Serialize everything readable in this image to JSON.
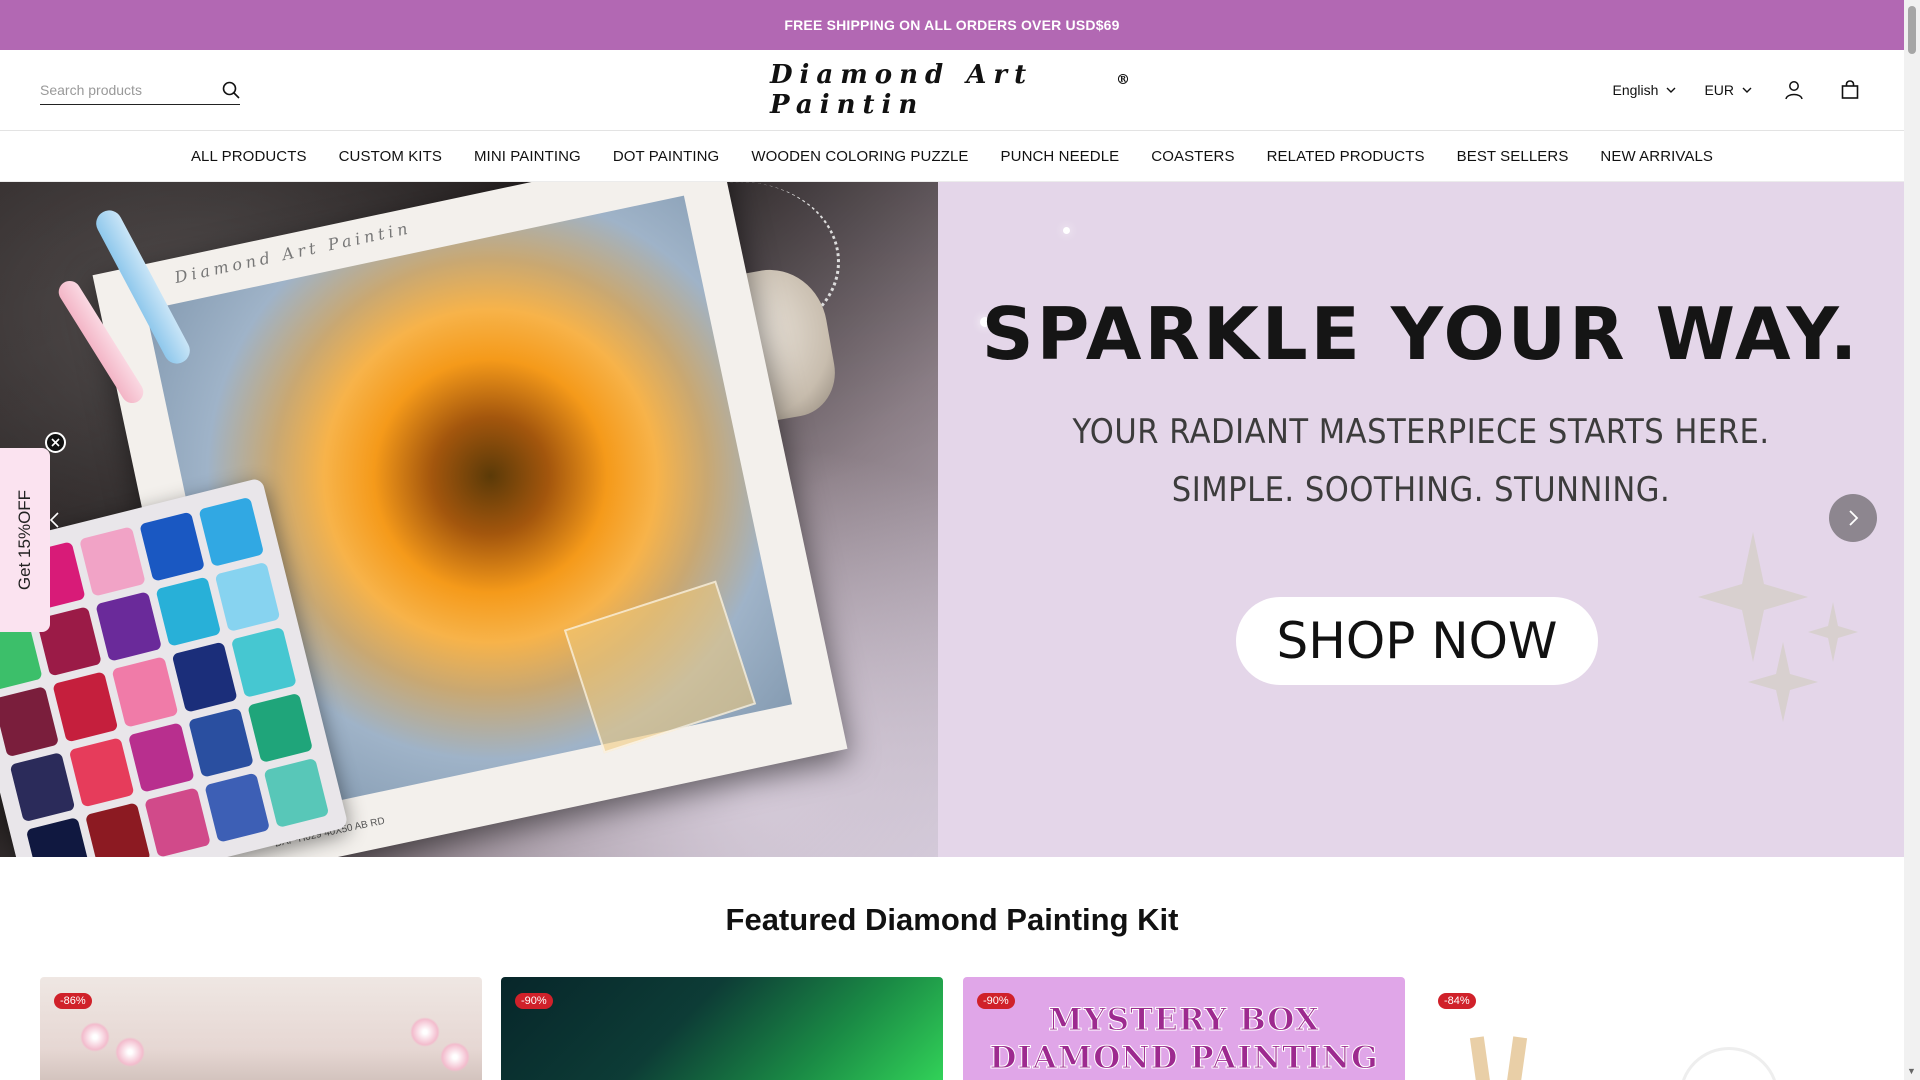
{
  "announcement": "FREE SHIPPING ON ALL ORDERS OVER USD$69",
  "header": {
    "search_placeholder": "Search products",
    "logo_text": "Diamond Art Paintin",
    "logo_mark": "®",
    "language": "English",
    "currency": "EUR"
  },
  "nav": [
    "ALL PRODUCTS",
    "CUSTOM KITS",
    "MINI PAINTING",
    "DOT PAINTING",
    "WOODEN COLORING PUZZLE",
    "PUNCH NEEDLE",
    "COASTERS",
    "RELATED PRODUCTS",
    "BEST SELLERS",
    "NEW ARRIVALS"
  ],
  "hero": {
    "title": "SPARKLE YOUR WAY.",
    "subtitle_1": "YOUR RADIANT MASTERPIECE STARTS HERE.",
    "subtitle_2": "SIMPLE. SOOTHING. STUNNING.",
    "cta": "SHOP NOW",
    "canvas_brand": "Diamond Art Paintin",
    "canvas_code": "DAP-H029 40X50 AB RD"
  },
  "promo_tab": "Get 15%OFF",
  "featured": {
    "title": "Featured Diamond Painting Kit",
    "cards": [
      {
        "badge": "-86%"
      },
      {
        "badge": "-90%"
      },
      {
        "badge": "-90%",
        "image_text_1": "MYSTERY BOX",
        "image_text_2": "DIAMOND PAINTING"
      },
      {
        "badge": "-84%"
      }
    ]
  },
  "colors": {
    "announcement_bg": "#b268b3",
    "hero_right_bg": "#e4d6e9",
    "badge": "#d0212a"
  }
}
